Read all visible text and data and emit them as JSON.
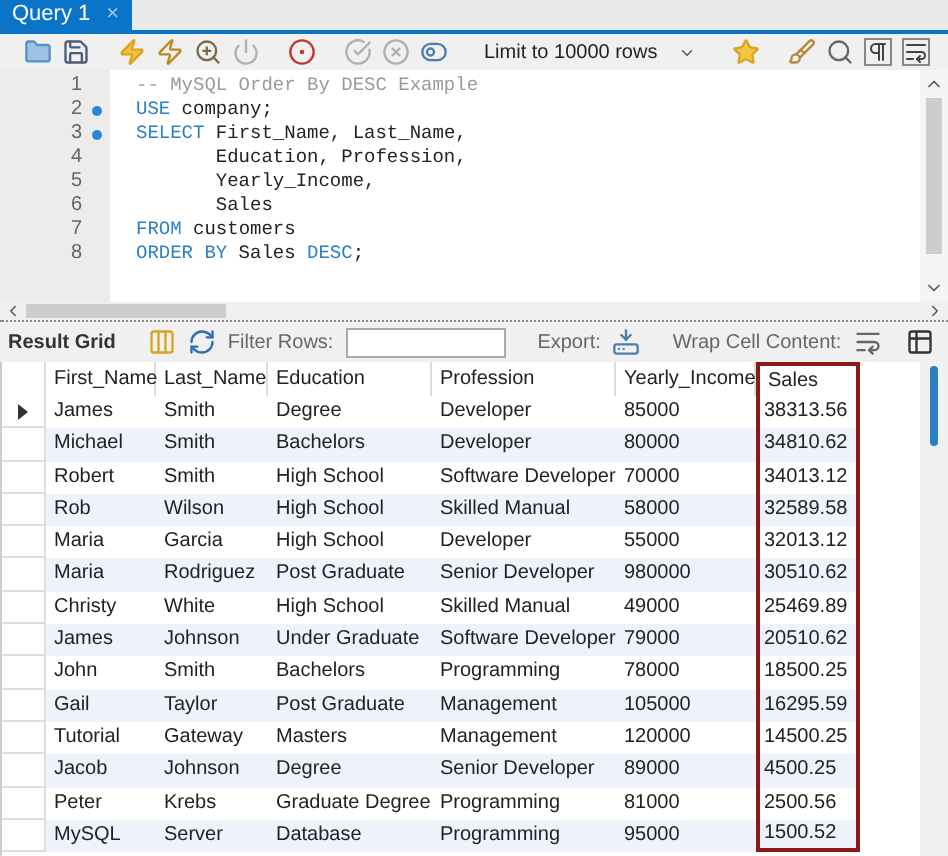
{
  "tabs": [
    {
      "label": "Query 1",
      "selected": true,
      "close": "×"
    }
  ],
  "toolbar": {
    "limit": "Limit to 10000 rows"
  },
  "editor": {
    "lines": [
      {
        "number": "1",
        "marker": false,
        "tokens": [
          {
            "kind": "comment",
            "text": "-- MySQL Order By DESC Example"
          }
        ]
      },
      {
        "number": "2",
        "marker": true,
        "tokens": [
          {
            "kind": "keyword",
            "text": "USE"
          },
          {
            "kind": "text",
            "text": " company;"
          }
        ]
      },
      {
        "number": "3",
        "marker": true,
        "tokens": [
          {
            "kind": "keyword",
            "text": "SELECT"
          },
          {
            "kind": "text",
            "text": " First_Name, Last_Name,"
          }
        ]
      },
      {
        "number": "4",
        "marker": false,
        "tokens": [
          {
            "kind": "text",
            "text": "       Education, Profession,"
          }
        ]
      },
      {
        "number": "5",
        "marker": false,
        "tokens": [
          {
            "kind": "text",
            "text": "       Yearly_Income,"
          }
        ]
      },
      {
        "number": "6",
        "marker": false,
        "tokens": [
          {
            "kind": "text",
            "text": "       Sales"
          }
        ]
      },
      {
        "number": "7",
        "marker": false,
        "tokens": [
          {
            "kind": "keyword",
            "text": "FROM"
          },
          {
            "kind": "text",
            "text": " customers"
          }
        ]
      },
      {
        "number": "8",
        "marker": false,
        "tokens": [
          {
            "kind": "keyword",
            "text": "ORDER BY"
          },
          {
            "kind": "text",
            "text": " Sales "
          },
          {
            "kind": "keyword",
            "text": "DESC"
          },
          {
            "kind": "text",
            "text": ";"
          }
        ]
      }
    ]
  },
  "result_toolbar": {
    "result_grid": "Result Grid",
    "filter_label": "Filter Rows:",
    "export_label": "Export:",
    "wrap_label": "Wrap Cell Content:"
  },
  "table": {
    "columns": [
      {
        "label": "First_Name",
        "highlighted": false
      },
      {
        "label": "Last_Name",
        "highlighted": false
      },
      {
        "label": "Education",
        "highlighted": false
      },
      {
        "label": "Profession",
        "highlighted": false
      },
      {
        "label": "Yearly_Income",
        "highlighted": false
      },
      {
        "label": "Sales",
        "highlighted": true
      }
    ],
    "rows": [
      {
        "selected": true,
        "cells": [
          "James",
          "Smith",
          "Degree",
          "Developer",
          "85000",
          "38313.56"
        ]
      },
      {
        "selected": false,
        "cells": [
          "Michael",
          "Smith",
          "Bachelors",
          "Developer",
          "80000",
          "34810.62"
        ]
      },
      {
        "selected": false,
        "cells": [
          "Robert",
          "Smith",
          "High School",
          "Software Developer",
          "70000",
          "34013.12"
        ]
      },
      {
        "selected": false,
        "cells": [
          "Rob",
          "Wilson",
          "High School",
          "Skilled Manual",
          "58000",
          "32589.58"
        ]
      },
      {
        "selected": false,
        "cells": [
          "Maria",
          "Garcia",
          "High School",
          "Developer",
          "55000",
          "32013.12"
        ]
      },
      {
        "selected": false,
        "cells": [
          "Maria",
          "Rodriguez",
          "Post Graduate",
          "Senior Developer",
          "980000",
          "30510.62"
        ]
      },
      {
        "selected": false,
        "cells": [
          "Christy",
          "White",
          "High School",
          "Skilled Manual",
          "49000",
          "25469.89"
        ]
      },
      {
        "selected": false,
        "cells": [
          "James",
          "Johnson",
          "Under Graduate",
          "Software Developer",
          "79000",
          "20510.62"
        ]
      },
      {
        "selected": false,
        "cells": [
          "John",
          "Smith",
          "Bachelors",
          "Programming",
          "78000",
          "18500.25"
        ]
      },
      {
        "selected": false,
        "cells": [
          "Gail",
          "Taylor",
          "Post Graduate",
          "Management",
          "105000",
          "16295.59"
        ]
      },
      {
        "selected": false,
        "cells": [
          "Tutorial",
          "Gateway",
          "Masters",
          "Management",
          "120000",
          "14500.25"
        ]
      },
      {
        "selected": false,
        "cells": [
          "Jacob",
          "Johnson",
          "Degree",
          "Senior Developer",
          "89000",
          "4500.25"
        ]
      },
      {
        "selected": false,
        "cells": [
          "Peter",
          "Krebs",
          "Graduate Degree",
          "Programming",
          "81000",
          "2500.56"
        ]
      },
      {
        "selected": false,
        "cells": [
          "MySQL",
          "Server",
          "Database",
          "Programming",
          "95000",
          "1500.52"
        ]
      }
    ]
  }
}
